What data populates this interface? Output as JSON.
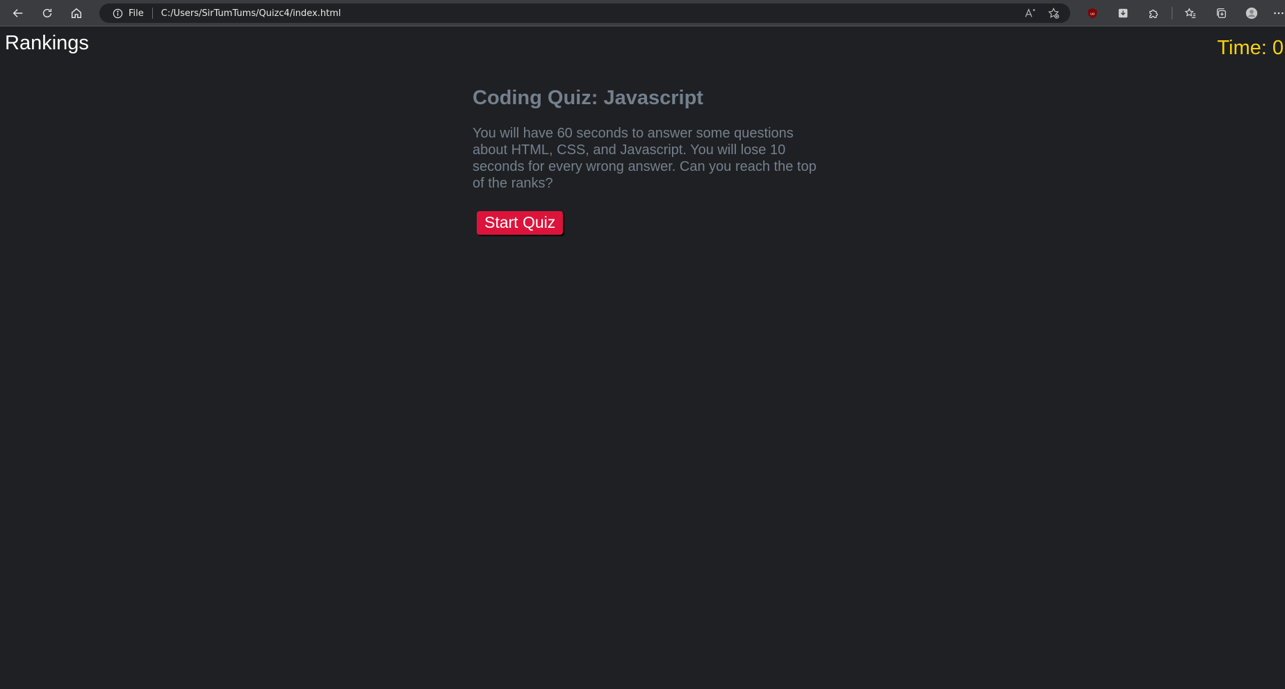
{
  "browser": {
    "protocol_label": "File",
    "url": "C:/Users/SirTumTums/Quizc4/index.html",
    "icons": [
      "back-arrow-icon",
      "reload-icon",
      "home-icon",
      "info-icon",
      "read-aloud-icon",
      "add-favorite-icon",
      "ublock-icon",
      "download-extension-icon",
      "extensions-icon",
      "favorites-icon",
      "collections-icon",
      "profile-icon",
      "more-icon"
    ]
  },
  "page": {
    "rankings_link": "Rankings",
    "timer_text": "Time: 0",
    "title": "Coding Quiz: Javascript",
    "description": "You will have 60 seconds to answer some questions about HTML, CSS, and Javascript. You will lose 10 seconds for every wrong answer. Can you reach the top of the ranks?",
    "start_button": "Start Quiz"
  },
  "colors": {
    "background": "#1f2023",
    "timer": "#f5d30f",
    "text_muted": "#74808e",
    "start_button": "#dc143c"
  }
}
